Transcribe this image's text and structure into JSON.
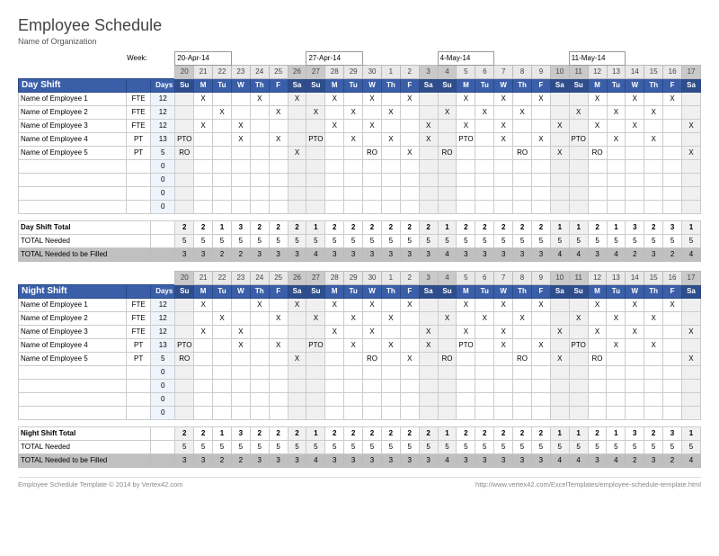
{
  "title": "Employee Schedule",
  "subtitle": "Name of Organization",
  "week_label": "Week:",
  "weeks": [
    "20-Apr-14",
    "27-Apr-14",
    "4-May-14",
    "11-May-14"
  ],
  "date_nums": [
    "20",
    "21",
    "22",
    "23",
    "24",
    "25",
    "26",
    "27",
    "28",
    "29",
    "30",
    "1",
    "2",
    "3",
    "4",
    "5",
    "6",
    "7",
    "8",
    "9",
    "10",
    "11",
    "12",
    "13",
    "14",
    "15",
    "16",
    "17"
  ],
  "dows": [
    "Su",
    "M",
    "Tu",
    "W",
    "Th",
    "F",
    "Sa",
    "Su",
    "M",
    "Tu",
    "W",
    "Th",
    "F",
    "Sa",
    "Su",
    "M",
    "Tu",
    "W",
    "Th",
    "F",
    "Sa",
    "Su",
    "M",
    "Tu",
    "W",
    "Th",
    "F",
    "Sa"
  ],
  "weekend_idx": [
    0,
    6,
    7,
    13,
    14,
    20,
    21,
    27
  ],
  "days_header": "Days",
  "shifts": [
    {
      "name": "Day Shift",
      "employees": [
        {
          "name": "Name of Employee 1",
          "type": "FTE",
          "days": "12",
          "marks": [
            "",
            "X",
            "",
            "",
            "X",
            "",
            "X",
            "",
            "X",
            "",
            "X",
            "",
            "X",
            "",
            "",
            "X",
            "",
            "X",
            "",
            "X",
            "",
            "",
            "X",
            "",
            "X",
            "",
            "X",
            ""
          ]
        },
        {
          "name": "Name of Employee 2",
          "type": "FTE",
          "days": "12",
          "marks": [
            "",
            "",
            "X",
            "",
            "",
            "X",
            "",
            "X",
            "",
            "X",
            "",
            "X",
            "",
            "",
            "X",
            "",
            "X",
            "",
            "X",
            "",
            "",
            "X",
            "",
            "X",
            "",
            "X",
            "",
            ""
          ]
        },
        {
          "name": "Name of Employee 3",
          "type": "FTE",
          "days": "12",
          "marks": [
            "",
            "X",
            "",
            "X",
            "",
            "",
            "",
            "",
            "X",
            "",
            "X",
            "",
            "",
            "X",
            "",
            "X",
            "",
            "X",
            "",
            "",
            "X",
            "",
            "X",
            "",
            "X",
            "",
            "",
            "X"
          ]
        },
        {
          "name": "Name of Employee 4",
          "type": "PT",
          "days": "13",
          "marks": [
            "PTO",
            "",
            "",
            "X",
            "",
            "X",
            "",
            "PTO",
            "",
            "X",
            "",
            "X",
            "",
            "X",
            "",
            "PTO",
            "",
            "X",
            "",
            "X",
            "",
            "PTO",
            "",
            "X",
            "",
            "X",
            "",
            ""
          ]
        },
        {
          "name": "Name of Employee 5",
          "type": "PT",
          "days": "5",
          "marks": [
            "RO",
            "",
            "",
            "",
            "",
            "",
            "X",
            "",
            "",
            "",
            "RO",
            "",
            "X",
            "",
            "RO",
            "",
            "",
            "",
            "RO",
            "",
            "X",
            "",
            "RO",
            "",
            "",
            "",
            "",
            "X"
          ]
        }
      ],
      "blank_rows": 4,
      "totals": {
        "shift_total_label": "Day Shift Total",
        "shift_total": [
          "2",
          "2",
          "1",
          "3",
          "2",
          "2",
          "2",
          "1",
          "2",
          "2",
          "2",
          "2",
          "2",
          "2",
          "1",
          "2",
          "2",
          "2",
          "2",
          "2",
          "1",
          "1",
          "2",
          "1",
          "3",
          "2",
          "3",
          "1"
        ],
        "needed_label": "TOTAL Needed",
        "needed": [
          "5",
          "5",
          "5",
          "5",
          "5",
          "5",
          "5",
          "5",
          "5",
          "5",
          "5",
          "5",
          "5",
          "5",
          "5",
          "5",
          "5",
          "5",
          "5",
          "5",
          "5",
          "5",
          "5",
          "5",
          "5",
          "5",
          "5",
          "5"
        ],
        "fill_label": "TOTAL Needed to be Filled",
        "fill": [
          "3",
          "3",
          "2",
          "2",
          "3",
          "3",
          "3",
          "4",
          "3",
          "3",
          "3",
          "3",
          "3",
          "3",
          "4",
          "3",
          "3",
          "3",
          "3",
          "3",
          "4",
          "4",
          "3",
          "4",
          "2",
          "3",
          "2",
          "4"
        ]
      }
    },
    {
      "name": "Night Shift",
      "employees": [
        {
          "name": "Name of Employee 1",
          "type": "FTE",
          "days": "12",
          "marks": [
            "",
            "X",
            "",
            "",
            "X",
            "",
            "X",
            "",
            "X",
            "",
            "X",
            "",
            "X",
            "",
            "",
            "X",
            "",
            "X",
            "",
            "X",
            "",
            "",
            "X",
            "",
            "X",
            "",
            "X",
            ""
          ]
        },
        {
          "name": "Name of Employee 2",
          "type": "FTE",
          "days": "12",
          "marks": [
            "",
            "",
            "X",
            "",
            "",
            "X",
            "",
            "X",
            "",
            "X",
            "",
            "X",
            "",
            "",
            "X",
            "",
            "X",
            "",
            "X",
            "",
            "",
            "X",
            "",
            "X",
            "",
            "X",
            "",
            ""
          ]
        },
        {
          "name": "Name of Employee 3",
          "type": "FTE",
          "days": "12",
          "marks": [
            "",
            "X",
            "",
            "X",
            "",
            "",
            "",
            "",
            "X",
            "",
            "X",
            "",
            "",
            "X",
            "",
            "X",
            "",
            "X",
            "",
            "",
            "X",
            "",
            "X",
            "",
            "X",
            "",
            "",
            "X"
          ]
        },
        {
          "name": "Name of Employee 4",
          "type": "PT",
          "days": "13",
          "marks": [
            "PTO",
            "",
            "",
            "X",
            "",
            "X",
            "",
            "PTO",
            "",
            "X",
            "",
            "X",
            "",
            "X",
            "",
            "PTO",
            "",
            "X",
            "",
            "X",
            "",
            "PTO",
            "",
            "X",
            "",
            "X",
            "",
            ""
          ]
        },
        {
          "name": "Name of Employee 5",
          "type": "PT",
          "days": "5",
          "marks": [
            "RO",
            "",
            "",
            "",
            "",
            "",
            "X",
            "",
            "",
            "",
            "RO",
            "",
            "X",
            "",
            "RO",
            "",
            "",
            "",
            "RO",
            "",
            "X",
            "",
            "RO",
            "",
            "",
            "",
            "",
            "X"
          ]
        }
      ],
      "blank_rows": 4,
      "totals": {
        "shift_total_label": "Night Shift Total",
        "shift_total": [
          "2",
          "2",
          "1",
          "3",
          "2",
          "2",
          "2",
          "1",
          "2",
          "2",
          "2",
          "2",
          "2",
          "2",
          "1",
          "2",
          "2",
          "2",
          "2",
          "2",
          "1",
          "1",
          "2",
          "1",
          "3",
          "2",
          "3",
          "1"
        ],
        "needed_label": "TOTAL Needed",
        "needed": [
          "5",
          "5",
          "5",
          "5",
          "5",
          "5",
          "5",
          "5",
          "5",
          "5",
          "5",
          "5",
          "5",
          "5",
          "5",
          "5",
          "5",
          "5",
          "5",
          "5",
          "5",
          "5",
          "5",
          "5",
          "5",
          "5",
          "5",
          "5"
        ],
        "fill_label": "TOTAL Needed to be Filled",
        "fill": [
          "3",
          "3",
          "2",
          "2",
          "3",
          "3",
          "3",
          "4",
          "3",
          "3",
          "3",
          "3",
          "3",
          "3",
          "4",
          "3",
          "3",
          "3",
          "3",
          "3",
          "4",
          "4",
          "3",
          "4",
          "2",
          "3",
          "2",
          "4"
        ]
      }
    }
  ],
  "footer_left": "Employee Schedule Template © 2014 by Vertex42.com",
  "footer_right": "http://www.vertex42.com/ExcelTemplates/employee-schedule-template.html"
}
